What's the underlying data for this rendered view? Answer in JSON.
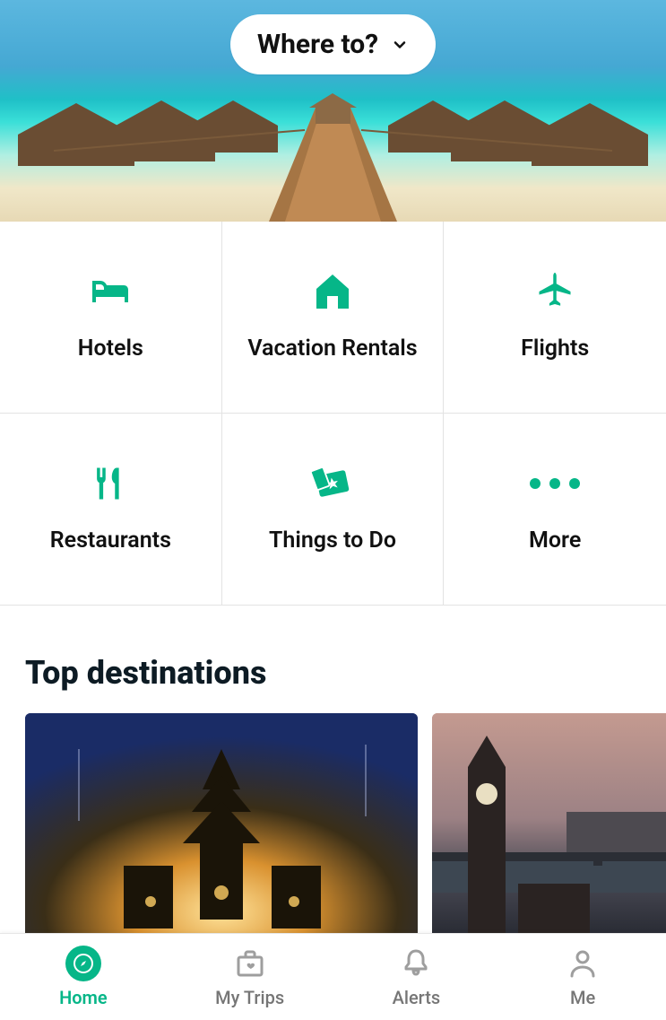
{
  "colors": {
    "accent": "#06b688",
    "text": "#111111",
    "muted": "#767676"
  },
  "header": {
    "search_label": "Where to?"
  },
  "categories": [
    {
      "id": "hotels",
      "label": "Hotels",
      "icon": "bed-icon"
    },
    {
      "id": "rentals",
      "label": "Vacation Rentals",
      "icon": "house-icon"
    },
    {
      "id": "flights",
      "label": "Flights",
      "icon": "plane-icon"
    },
    {
      "id": "food",
      "label": "Restaurants",
      "icon": "fork-knife-icon"
    },
    {
      "id": "things",
      "label": "Things to Do",
      "icon": "ticket-icon"
    },
    {
      "id": "more",
      "label": "More",
      "icon": "dots-icon"
    }
  ],
  "section": {
    "title": "Top destinations"
  },
  "destinations": [
    {
      "id": "bali",
      "image": "bali-temple-evening"
    },
    {
      "id": "london",
      "image": "london-bigben-dusk"
    }
  ],
  "nav": [
    {
      "id": "home",
      "label": "Home",
      "icon": "compass-icon",
      "active": true
    },
    {
      "id": "trips",
      "label": "My Trips",
      "icon": "suitcase-heart-icon",
      "active": false
    },
    {
      "id": "alerts",
      "label": "Alerts",
      "icon": "bell-icon",
      "active": false
    },
    {
      "id": "me",
      "label": "Me",
      "icon": "person-icon",
      "active": false
    }
  ]
}
